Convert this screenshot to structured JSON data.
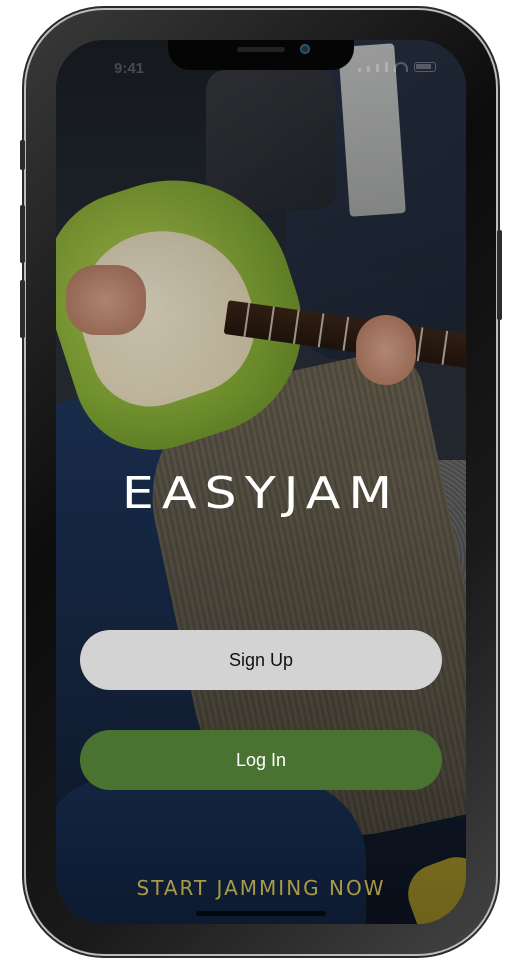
{
  "status_bar": {
    "time": "9:41"
  },
  "app": {
    "title": "EASYJAM",
    "tagline": "START JAMMING NOW"
  },
  "buttons": {
    "sign_up": "Sign Up",
    "log_in": "Log In"
  },
  "colors": {
    "sign_up_bg": "#d3d3d3",
    "log_in_bg": "#4a7332",
    "tagline": "#b9a84a",
    "title": "#ffffff"
  }
}
